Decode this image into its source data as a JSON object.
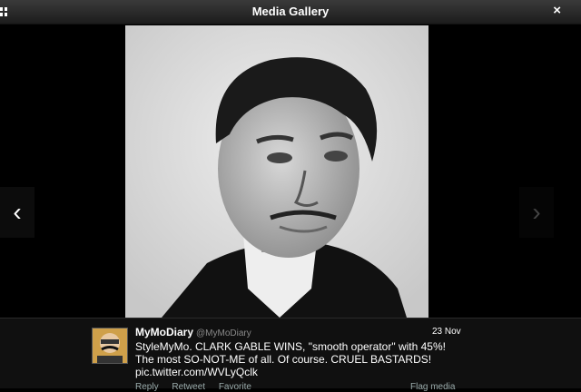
{
  "header": {
    "title": "Media Gallery",
    "close_label": "×"
  },
  "nav": {
    "prev_label": "‹",
    "next_label": "›"
  },
  "tweet": {
    "name": "MyMoDiary",
    "handle": "@MyMoDiary",
    "date": "23 Nov",
    "text": "StyleMyMo. CLARK GABLE WINS, \"smooth operator\" with 45%! The most SO-NOT-ME of all. Of course. CRUEL BASTARDS!",
    "link": "pic.twitter.com/WVLyQclk",
    "actions": {
      "reply": "Reply",
      "retweet": "Retweet",
      "favorite": "Favorite",
      "flag": "Flag media"
    }
  },
  "icons": {
    "grid": "grid-icon",
    "close": "close-icon",
    "prev": "chevron-left-icon",
    "next": "chevron-right-icon"
  }
}
